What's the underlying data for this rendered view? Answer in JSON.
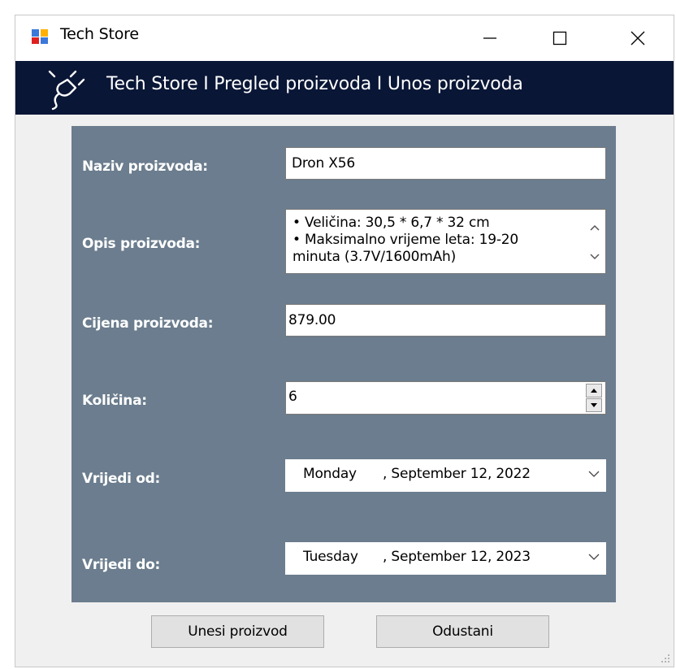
{
  "window": {
    "title": "Tech Store",
    "controls": {
      "minimize": "—",
      "maximize": "☐",
      "close": "✕"
    }
  },
  "banner": {
    "text": "Tech Store I Pregled proizvoda I Unos proizvoda",
    "icon": "plug-icon",
    "background": "#0a1636"
  },
  "form": {
    "panel_color": "#6b7d8e",
    "naziv": {
      "label": "Naziv proizvoda:",
      "value": "Dron X56"
    },
    "opis": {
      "label": "Opis proizvoda:",
      "lines": [
        "• Veličina: 30,5 * 6,7 * 32 cm",
        "• Maksimalno vrijeme leta: 19-20",
        "minuta (3.7V/1600mAh)"
      ]
    },
    "cijena": {
      "label": "Cijena proizvoda:",
      "value": "879.00"
    },
    "kolicina": {
      "label": "Količina:",
      "value": "6"
    },
    "vrijedi_od": {
      "label": "Vrijedi od:",
      "day": "Monday",
      "date": ", September 12, 2022"
    },
    "vrijedi_do": {
      "label": "Vrijedi do:",
      "day": "Tuesday",
      "date": ", September 12, 2023"
    }
  },
  "buttons": {
    "submit": "Unesi proizvod",
    "cancel": "Odustani"
  }
}
